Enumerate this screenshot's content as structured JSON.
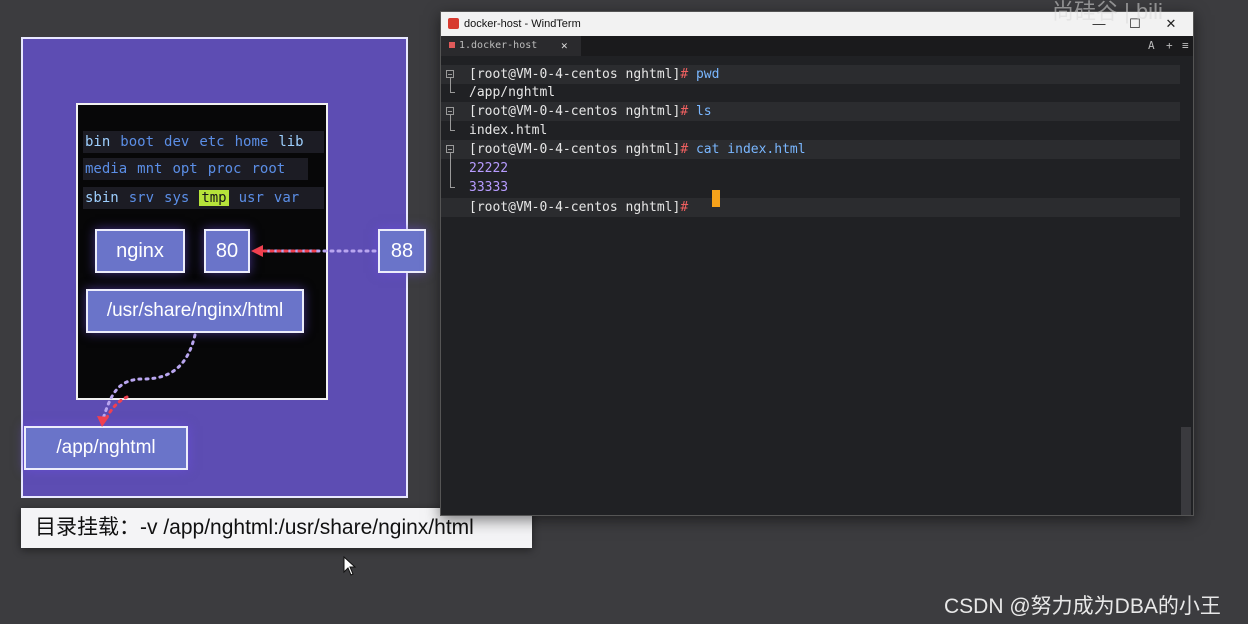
{
  "diagram": {
    "dir_rows": [
      [
        {
          "t": "bin",
          "em": true
        },
        {
          "t": "boot"
        },
        {
          "t": "dev"
        },
        {
          "t": "etc"
        },
        {
          "t": "home"
        },
        {
          "t": "lib",
          "em": true
        }
      ],
      [
        {
          "t": "media"
        },
        {
          "t": "mnt"
        },
        {
          "t": "opt"
        },
        {
          "t": "proc"
        },
        {
          "t": "root"
        }
      ],
      [
        {
          "t": "sbin",
          "em": true
        },
        {
          "t": "srv"
        },
        {
          "t": "sys"
        },
        {
          "t": "tmp",
          "hl": true
        },
        {
          "t": "usr"
        },
        {
          "t": "var"
        }
      ]
    ],
    "nginx_label": "nginx",
    "container_port": "80",
    "host_port": "88",
    "container_path": "/usr/share/nginx/html",
    "host_path": "/app/nghtml"
  },
  "caption": "目录挂载：-v /app/nghtml:/usr/share/nginx/html",
  "window": {
    "title": "docker-host - WindTerm",
    "tab_label": "1.docker-host",
    "tab_buttons": [
      "A",
      "+",
      "≡"
    ]
  },
  "terminal": {
    "lines": [
      {
        "prompt": "[root@VM-0-4-centos nghtml]",
        "hash": "#",
        "cmd": " pwd"
      },
      {
        "out": "/app/nghtml"
      },
      {
        "prompt": "[root@VM-0-4-centos nghtml]",
        "hash": "#",
        "cmd": " ls"
      },
      {
        "out": "index.html"
      },
      {
        "prompt": "[root@VM-0-4-centos nghtml]",
        "hash": "#",
        "cmd": " cat index.html"
      },
      {
        "out": "22222",
        "num": true
      },
      {
        "out": "33333",
        "num": true
      },
      {
        "prompt": "[root@VM-0-4-centos nghtml]",
        "hash": "#",
        "cmd": " "
      }
    ]
  },
  "watermark": "CSDN @努力成为DBA的小王",
  "corner_logo": "尚硅谷 | bili",
  "colors": {
    "diagram_bg": "#5d4db3",
    "box_fill": "#6a74c9",
    "arrow_red": "#f04050",
    "arrow_purple": "#b9a6f0",
    "prompt_hash": "#f06060",
    "command": "#7ab7ff",
    "output_number": "#b79cff",
    "caret": "#f5a21b"
  }
}
